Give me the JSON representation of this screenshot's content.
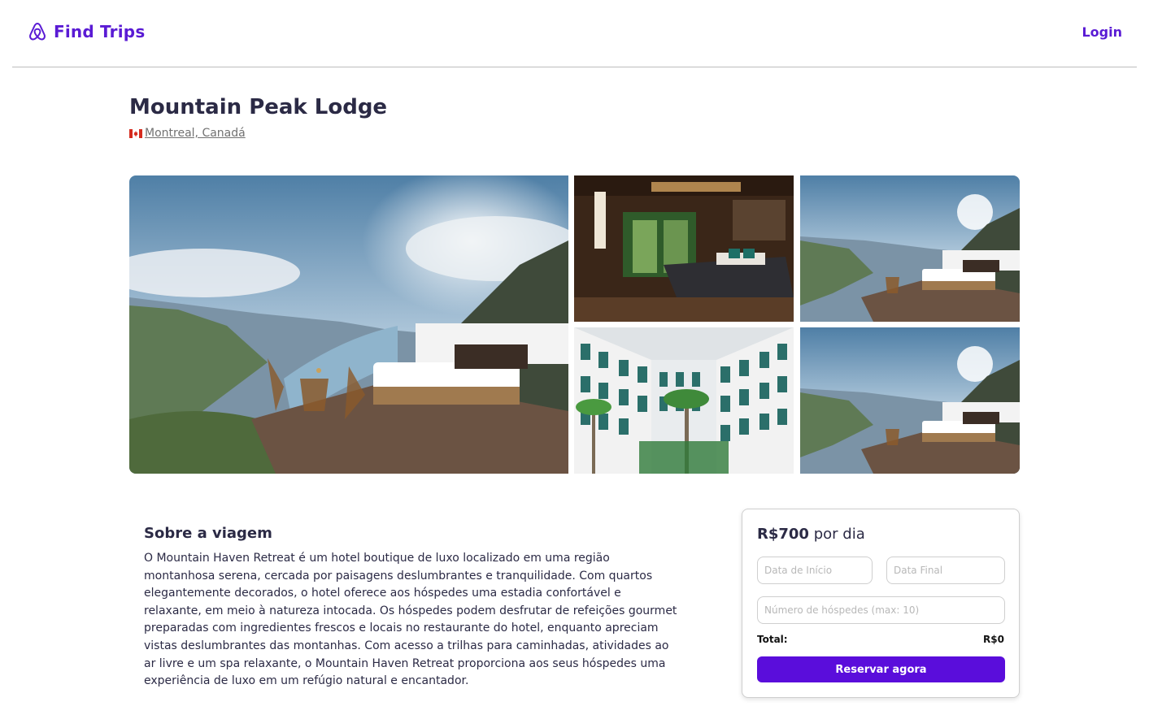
{
  "header": {
    "brand": "Find Trips",
    "brand_icon": "airbnb-style-logo-icon",
    "login_label": "Login",
    "accent_color": "#5a1bd4"
  },
  "trip": {
    "title": "Mountain Peak Lodge",
    "location": "Montreal, Canadá",
    "flag_icon": "canada-flag-icon"
  },
  "gallery": {
    "photos": [
      "mountain-deck-bed-photo",
      "hotel-bedroom-photo",
      "mountain-deck-bed-photo",
      "hotel-courtyard-photo",
      "mountain-deck-bed-photo"
    ]
  },
  "about": {
    "heading": "Sobre a viagem",
    "text": "O Mountain Haven Retreat é um hotel boutique de luxo localizado em uma região montanhosa serena, cercada por paisagens deslumbrantes e tranquilidade. Com quartos elegantemente decorados, o hotel oferece aos hóspedes uma estadia confortável e relaxante, em meio à natureza intocada. Os hóspedes podem desfrutar de refeições gourmet preparadas com ingredientes frescos e locais no restaurante do hotel, enquanto apreciam vistas deslumbrantes das montanhas. Com acesso a trilhas para caminhadas, atividades ao ar livre e um spa relaxante, o Mountain Haven Retreat proporciona aos seus hóspedes uma experiência de luxo em um refúgio natural e encantador."
  },
  "booking": {
    "price": "R$700",
    "price_suffix": "por dia",
    "start_placeholder": "Data de Início",
    "end_placeholder": "Data Final",
    "guests_placeholder": "Número de hóspedes (max: 10)",
    "total_label": "Total:",
    "total_value": "R$0",
    "reserve_label": "Reservar agora",
    "button_color": "#5a0ddb"
  }
}
